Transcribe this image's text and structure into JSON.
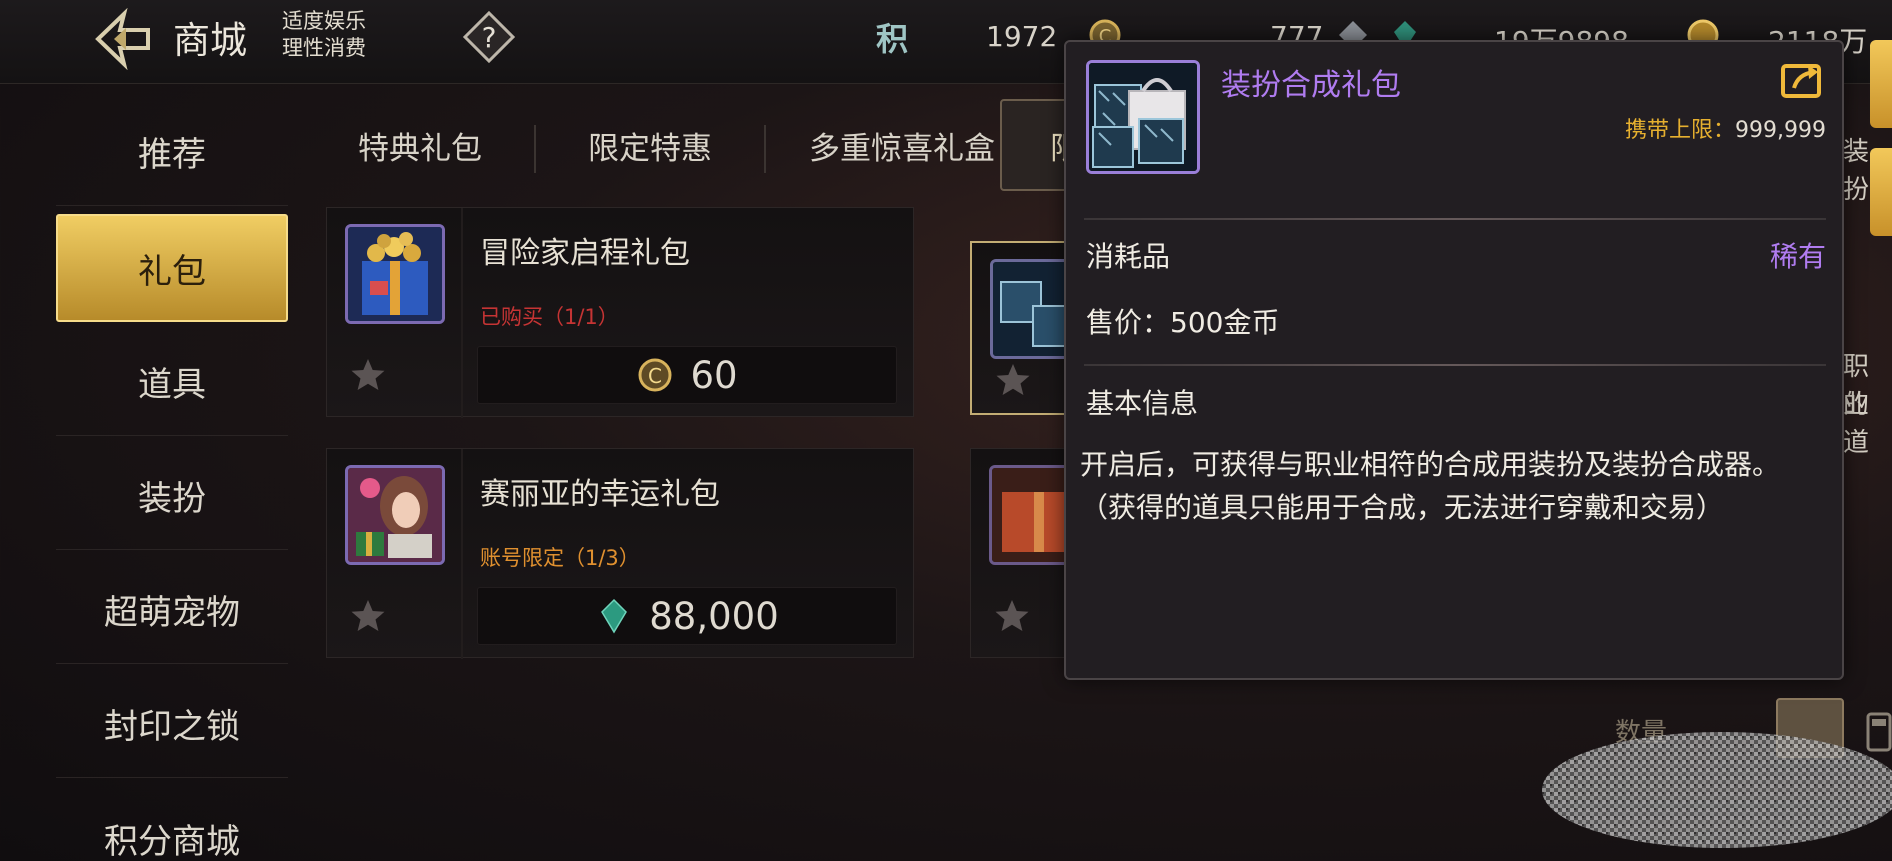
{
  "header": {
    "title": "商城",
    "slogan_line1": "适度娱乐",
    "slogan_line2": "理性消费",
    "points_label": "积",
    "currencies": [
      {
        "icon": "gold-coin-icon",
        "value": "1972"
      },
      {
        "icon": "diamond-icon",
        "value": "777"
      },
      {
        "icon": "gem-icon",
        "value": "19万9898"
      },
      {
        "icon": "coin-icon",
        "value": "2118万"
      }
    ]
  },
  "sidebar": {
    "items": [
      {
        "label": "推荐"
      },
      {
        "label": "礼包",
        "active": true
      },
      {
        "label": "道具"
      },
      {
        "label": "装扮"
      },
      {
        "label": "超萌宠物"
      },
      {
        "label": "封印之锁"
      },
      {
        "label": "积分商城"
      }
    ]
  },
  "tabs": [
    {
      "label": "特典礼包"
    },
    {
      "label": "限定特惠"
    },
    {
      "label": "多重惊喜礼盒"
    },
    {
      "label": "限",
      "active": true
    }
  ],
  "products": [
    {
      "name": "冒险家启程礼包",
      "limit": "已购买（1/1）",
      "price": "60",
      "currency": "gold-coin-icon"
    },
    {
      "name": "赛丽亚的幸运礼包",
      "limit": "账号限定（1/3）",
      "price": "88,000",
      "currency": "gem-icon"
    }
  ],
  "tooltip": {
    "name": "装扮合成礼包",
    "carry_label": "携带上限：",
    "carry_value": "999,999",
    "type": "消耗品",
    "rarity": "稀有",
    "price": "售价：500金币",
    "section_title": "基本信息",
    "description": "开启后，可获得与职业相符的合成用装扮及装扮合成器。（获得的道具只能用于合成，无法进行穿戴和交易）"
  },
  "edge": {
    "text_top": "装扮",
    "text_mid_1": "职业",
    "text_mid_2": "的道",
    "quantity_label": "数量"
  },
  "colors": {
    "accent_gold": "#f0cd63",
    "rare_purple": "#b07cf0",
    "bought_red": "#c63434",
    "account_orange": "#e0902f"
  }
}
